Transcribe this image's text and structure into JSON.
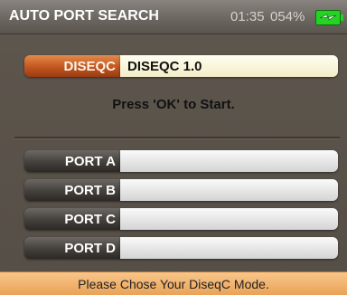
{
  "header": {
    "title": "AUTO PORT SEARCH",
    "time": "01:35",
    "battery_percent": "054%",
    "battery_icon": "battery-charging-icon",
    "battery_color": "#25d225"
  },
  "diseqc": {
    "label": "DISEQC",
    "value": "DISEQC 1.0"
  },
  "instruction": "Press 'OK' to Start.",
  "ports": [
    {
      "label": "PORT A"
    },
    {
      "label": "PORT B"
    },
    {
      "label": "PORT C"
    },
    {
      "label": "PORT D"
    }
  ],
  "footer": {
    "hint": "Please Chose Your DiseqC Mode."
  },
  "colors": {
    "accent_orange": "#c2561f",
    "footer_bg": "#eaa257"
  }
}
